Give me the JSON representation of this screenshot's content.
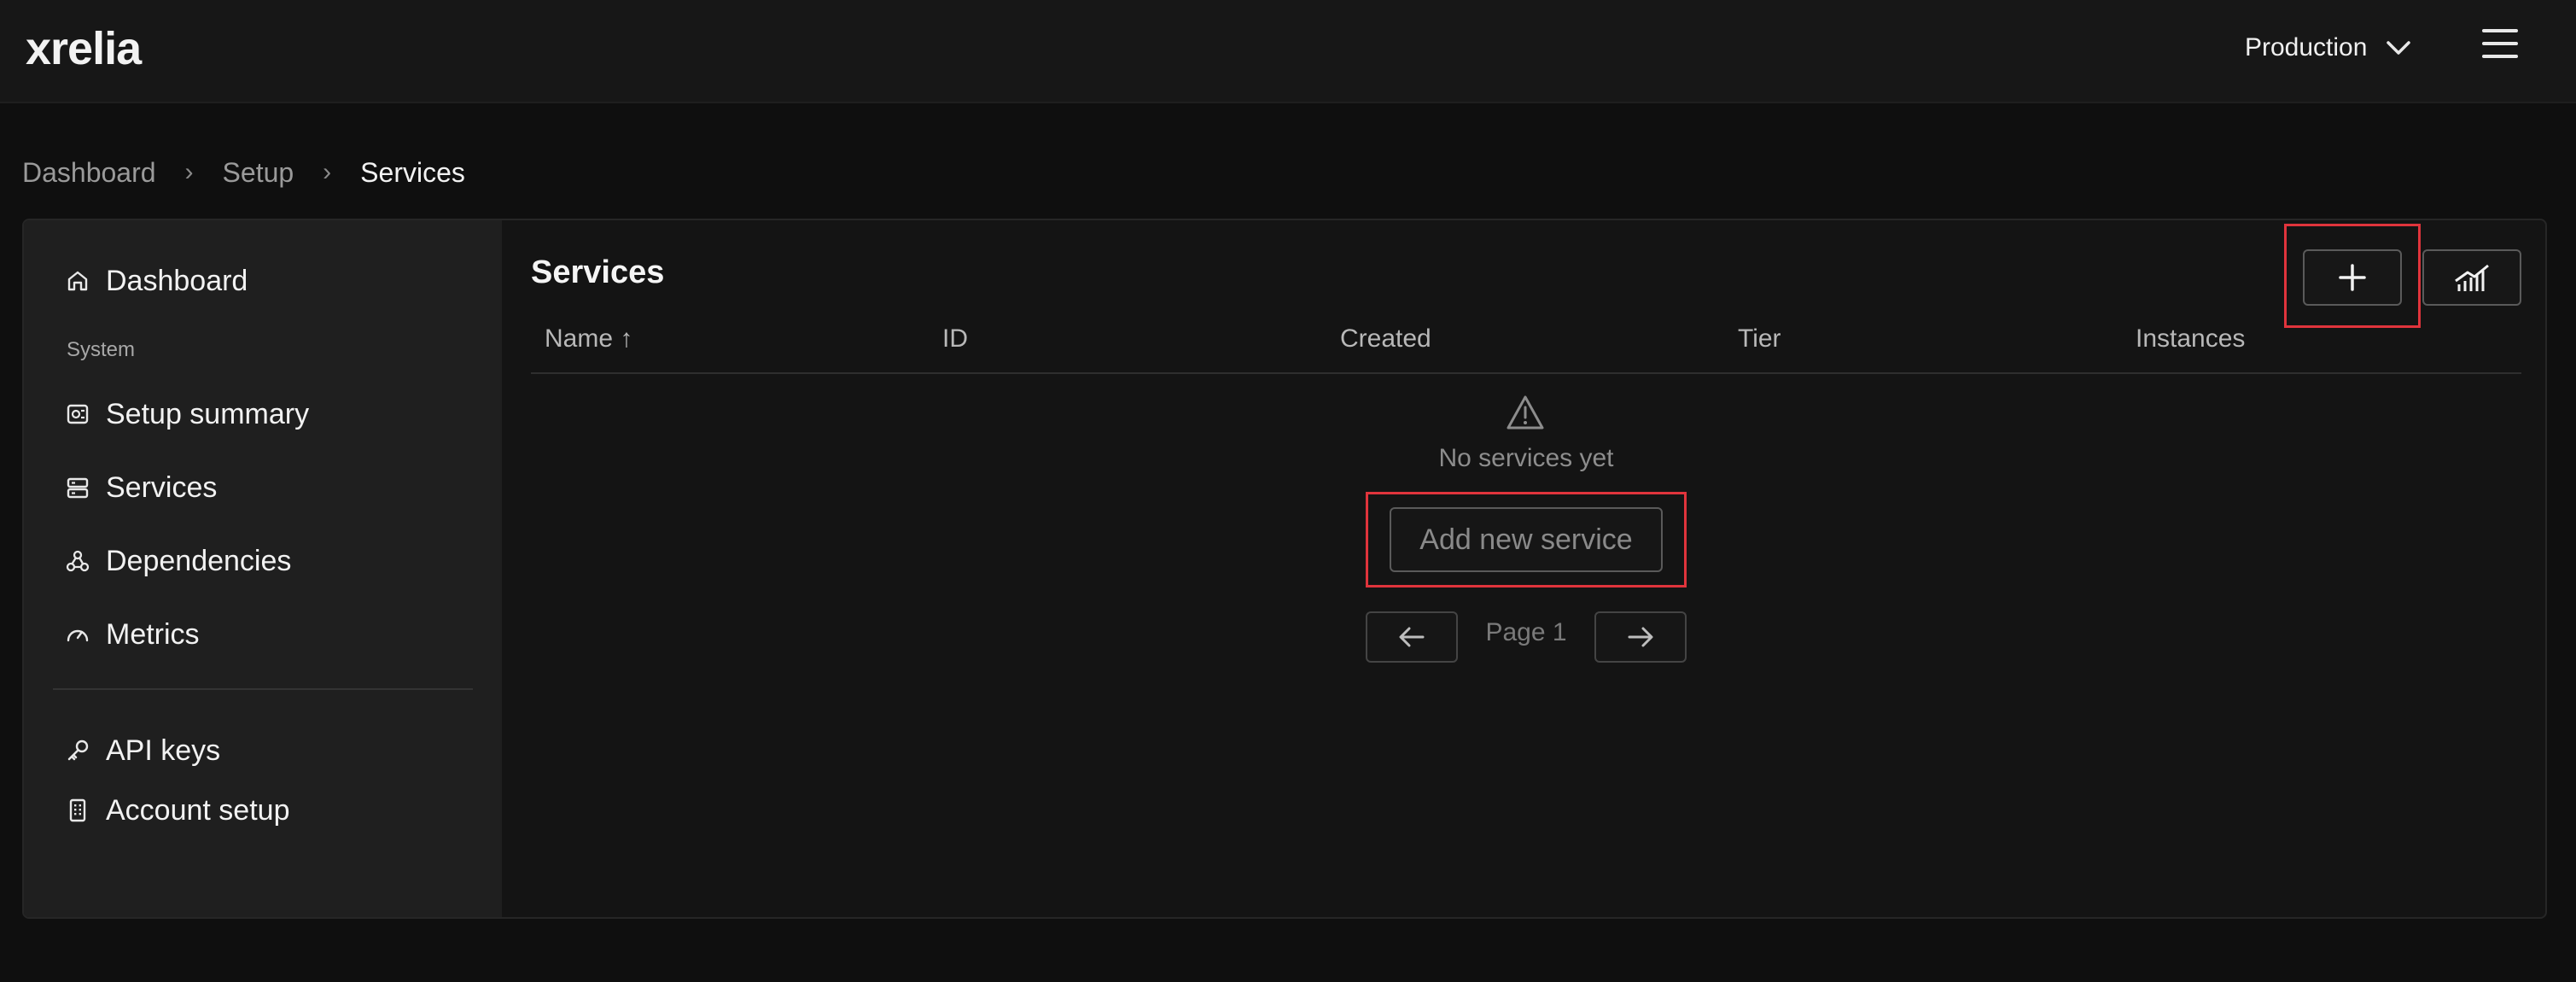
{
  "app": {
    "logo": "xrelia"
  },
  "header": {
    "environment": "Production"
  },
  "breadcrumb": [
    "Dashboard",
    "Setup",
    "Services"
  ],
  "sidebar": {
    "top_item": "Dashboard",
    "section_label": "System",
    "items": [
      "Setup summary",
      "Services",
      "Dependencies",
      "Metrics"
    ],
    "bottom_items": [
      "API keys",
      "Account setup"
    ]
  },
  "main": {
    "title": "Services",
    "columns": [
      "Name",
      "ID",
      "Created",
      "Tier",
      "Instances"
    ],
    "sort_indicator": "↑",
    "empty_text": "No services yet",
    "add_button": "Add new service",
    "page_label": "Page 1"
  },
  "icons": {
    "add": "plus-icon",
    "stats": "chart-icon",
    "empty": "warning-icon",
    "prev": "arrow-left-icon",
    "next": "arrow-right-icon"
  },
  "colors": {
    "highlight": "#e0343c",
    "background": "#0f0f0f",
    "sidebar": "#1f1f1f"
  }
}
